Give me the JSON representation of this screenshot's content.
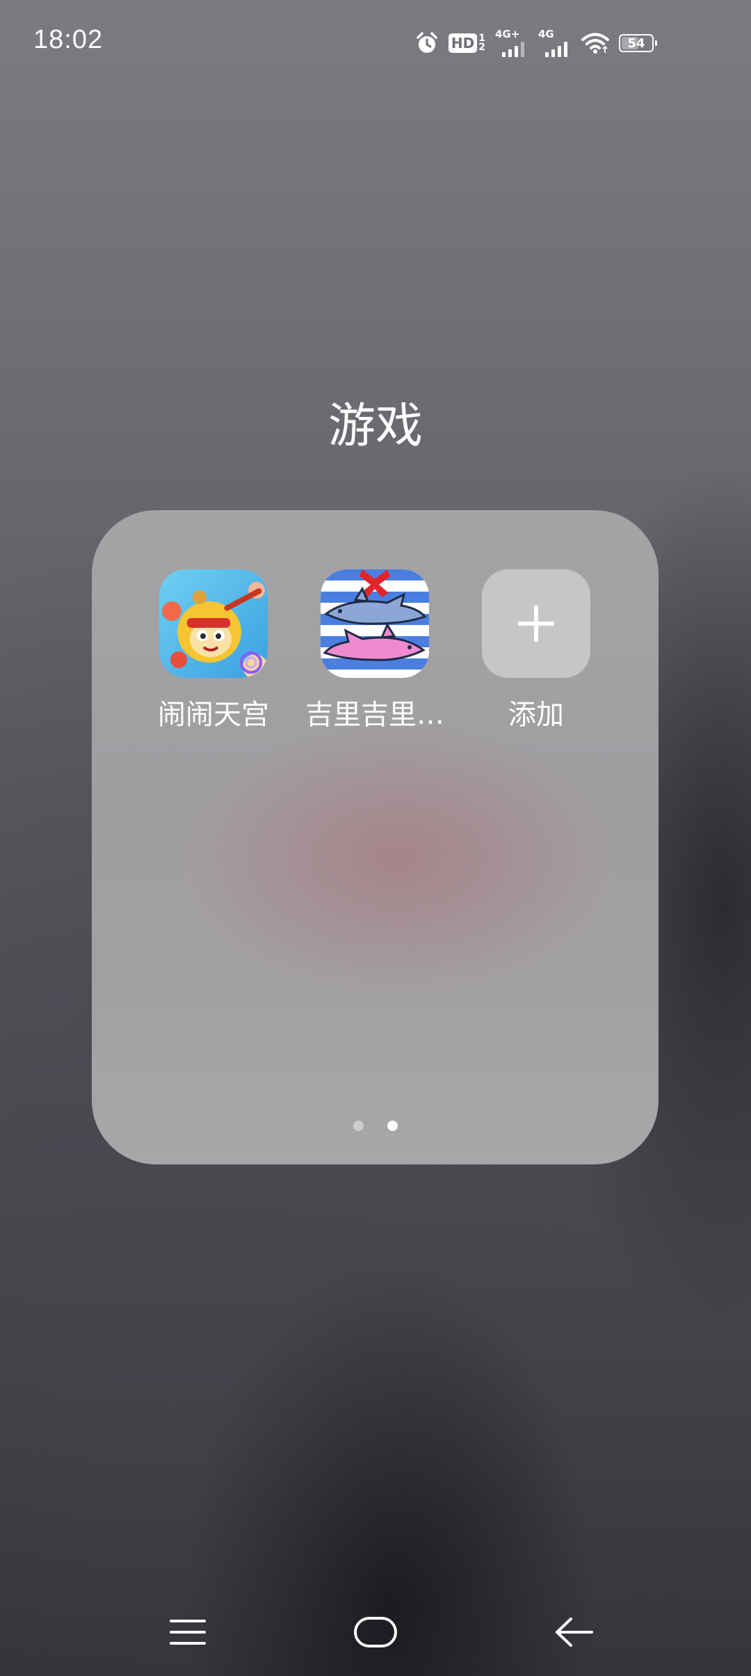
{
  "status_bar": {
    "time": "18:02",
    "hd_label": "HD",
    "hd_sub_top": "1",
    "hd_sub_bottom": "2",
    "sim1_network": "4G+",
    "sim2_network": "4G",
    "battery_level": "54",
    "icons": [
      "alarm-icon",
      "hd-volte-icon",
      "signal-icon",
      "signal-icon",
      "wifi-icon",
      "battery-icon"
    ]
  },
  "folder": {
    "title": "游戏",
    "apps": [
      {
        "label": "闹闹天宫",
        "icon": "game-monkey-king-icon"
      },
      {
        "label": "吉里吉里…",
        "icon": "game-sharks-icon"
      },
      {
        "label": "添加",
        "icon": "plus-icon"
      }
    ],
    "pages": {
      "count": 2,
      "active": 2
    }
  },
  "nav_bar": {
    "items": [
      "menu-icon",
      "home-icon",
      "back-icon"
    ]
  },
  "colors": {
    "accent": "#ffffff",
    "folder_bg": "#a3a2a4"
  }
}
